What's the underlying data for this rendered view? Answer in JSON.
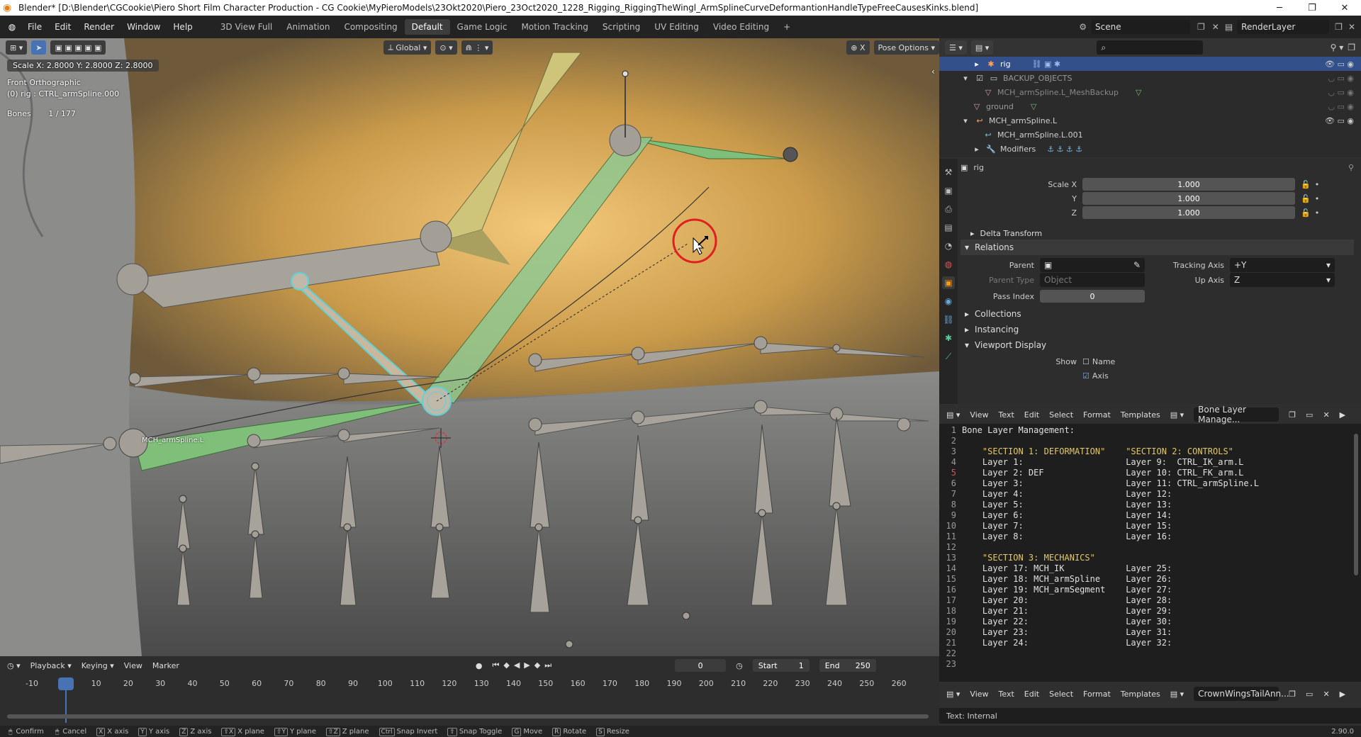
{
  "window": {
    "title": "Blender* [D:\\Blender\\CGCookie\\Piero Short Film Character Production - CG Cookie\\MyPieroModels\\23Okt2020\\Piero_23Oct2020_1228_Rigging_RiggingTheWingl_ArmSplineCurveDeformantionHandleTypeFreeCausesKinks.blend]"
  },
  "menu": [
    "File",
    "Edit",
    "Render",
    "Window",
    "Help"
  ],
  "workspaces": [
    "3D View Full",
    "Animation",
    "Compositing",
    "Default",
    "Game Logic",
    "Motion Tracking",
    "Scripting",
    "UV Editing",
    "Video Editing"
  ],
  "active_workspace": "Default",
  "scene": {
    "name": "Scene",
    "render_layer": "RenderLayer"
  },
  "viewport": {
    "transform_orientation": "Global",
    "pose_options": "Pose Options",
    "scale_readout": "Scale X: 2.8000   Y: 2.8000   Z: 2.8000",
    "view_name": "Front Orthographic",
    "active_object": "(0) rig : CTRL_armSpline.000",
    "bones_label": "Bones",
    "bones_count": "1 / 177",
    "bone_label_text": "MCH_armSpline.L"
  },
  "outliner": {
    "rows": [
      {
        "name": "rig",
        "indent": 1,
        "selected": true
      },
      {
        "name": "BACKUP_OBJECTS",
        "indent": 1,
        "selected": false
      },
      {
        "name": "MCH_armSpline.L_MeshBackup",
        "indent": 2,
        "selected": false
      },
      {
        "name": "ground",
        "indent": 1,
        "selected": false
      },
      {
        "name": "MCH_armSpline.L",
        "indent": 1,
        "selected": false
      },
      {
        "name": "MCH_armSpline.L.001",
        "indent": 2,
        "selected": false
      },
      {
        "name": "Modifiers",
        "indent": 2,
        "selected": false
      }
    ]
  },
  "properties": {
    "object_name": "rig",
    "scale": {
      "label": "Scale X",
      "x": "1.000",
      "y_label": "Y",
      "y": "1.000",
      "z_label": "Z",
      "z": "1.000"
    },
    "delta_transform": "Delta Transform",
    "relations": "Relations",
    "parent_label": "Parent",
    "parent_type_label": "Parent Type",
    "parent_type": "Object",
    "tracking_axis_label": "Tracking Axis",
    "tracking_axis": "+Y",
    "up_axis_label": "Up Axis",
    "up_axis": "Z",
    "pass_index_label": "Pass Index",
    "pass_index": "0",
    "collections": "Collections",
    "instancing": "Instancing",
    "viewport_display": "Viewport Display",
    "show_label": "Show",
    "show_name": "Name",
    "show_axis": "Axis"
  },
  "text_editor": {
    "menu": [
      "View",
      "Text",
      "Edit",
      "Select",
      "Format",
      "Templates"
    ],
    "file": "Bone Layer Manage...",
    "lines": [
      "Bone Layer Management:",
      "",
      "    \"SECTION 1: DEFORMATION\"    \"SECTION 2: CONTROLS\"",
      "    Layer 1:                    Layer 9:  CTRL_IK_arm.L",
      "    Layer 2: DEF                Layer 10: CTRL_FK_arm.L",
      "    Layer 3:                    Layer 11: CTRL_armSpline.L",
      "    Layer 4:                    Layer 12:",
      "    Layer 5:                    Layer 13:",
      "    Layer 6:                    Layer 14:",
      "    Layer 7:                    Layer 15:",
      "    Layer 8:                    Layer 16:",
      "",
      "    \"SECTION 3: MECHANICS\"",
      "    Layer 17: MCH_IK            Layer 25:",
      "    Layer 18: MCH_armSpline     Layer 26:",
      "    Layer 19: MCH_armSegment    Layer 27:",
      "    Layer 20:                   Layer 28:",
      "    Layer 21:                   Layer 29:",
      "    Layer 22:                   Layer 30:",
      "    Layer 23:                   Layer 31:",
      "    Layer 24:                   Layer 32:",
      "",
      ""
    ],
    "footer": "Text: Internal",
    "second_file": "CrownWingsTailAnn...",
    "second_footer": "Text: Internal"
  },
  "timeline": {
    "menu": [
      "Playback",
      "Keying",
      "View",
      "Marker"
    ],
    "current_frame": "0",
    "start_label": "Start",
    "start": "1",
    "end_label": "End",
    "end": "250",
    "ticks": [
      "-10",
      "0",
      "10",
      "20",
      "30",
      "40",
      "50",
      "60",
      "70",
      "80",
      "90",
      "100",
      "110",
      "120",
      "130",
      "140",
      "150",
      "160",
      "170",
      "180",
      "190",
      "200",
      "210",
      "220",
      "230",
      "240",
      "250",
      "260"
    ]
  },
  "statusbar": {
    "items": [
      {
        "key": "",
        "label": "Confirm"
      },
      {
        "key": "",
        "label": "Cancel"
      },
      {
        "key": "X",
        "label": "X axis"
      },
      {
        "key": "Y",
        "label": "Y axis"
      },
      {
        "key": "Z",
        "label": "Z axis"
      },
      {
        "key": "⇧X",
        "label": "X plane"
      },
      {
        "key": "⇧Y",
        "label": "Y plane"
      },
      {
        "key": "⇧Z",
        "label": "Z plane"
      },
      {
        "key": "Ctrl",
        "label": "Snap Invert"
      },
      {
        "key": "⇧",
        "label": "Snap Toggle"
      },
      {
        "key": "G",
        "label": "Move"
      },
      {
        "key": "R",
        "label": "Rotate"
      },
      {
        "key": "S",
        "label": "Resize"
      }
    ],
    "version": "2.90.0"
  },
  "colors": {
    "accent": "#4772b3",
    "bone_green": "#7fbf7a",
    "bone_yellow": "#d8cf7a",
    "cursor_ring": "#e02020"
  }
}
